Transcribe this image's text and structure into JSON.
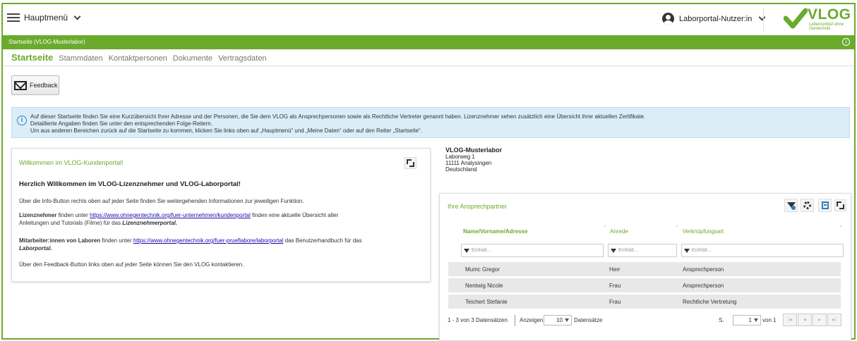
{
  "header": {
    "menu_label": "Hauptmenü",
    "user_label": "Laborportal-Nutzer:in",
    "logo_text": "VLOG",
    "logo_sub": "Lebensmittel ohne Gentechnik"
  },
  "breadcrumb": "Startseite (VLOG-Musterlabor)",
  "tabs": [
    "Startseite",
    "Stammdaten",
    "Kontaktpersonen",
    "Dokumente",
    "Vertragsdaten"
  ],
  "feedback_label": "Feedback",
  "banner": {
    "line1": "Auf dieser Startseite finden Sie eine Kurzübersicht Ihrer Adresse und der Personen, die Sie dem VLOG als Ansprechpersonen sowie als Rechtliche Vertreter genannt haben. Lizenznehmer sehen zusätzlich eine Übersicht ihrer aktuellen Zertifikate.",
    "line2": "Detaillierte Angaben finden Sie unter den entsprechenden Folge-Reitern.",
    "line3": "Um aus anderen Bereichen zurück auf die Startseite zu kommen, klicken Sie links oben auf „Hauptmenü“ und „Meine Daten“ oder auf den Reiter „Startseite“."
  },
  "welcome": {
    "title": "Willkommen im VLOG-Kundenportal!",
    "heading": "Herzlich Willkommen im VLOG-Lizenznehmer und VLOG-Laborportal!",
    "p1": "Über die Info-Button rechts oben auf jeder Seite finden Sie weitergehenden Informationen zur jeweiligen Funktion.",
    "p2_bold": "Lizenznehmer",
    "p2_pre": " finden unter ",
    "p2_link": "https://www.ohnegentechnik.org/fuer-unternehmen/kundenportal",
    "p2_post": " finden eine aktuelle Übersicht aller",
    "p2_line2": "Anleitungen und Tutorials (Filme) für das ",
    "p2_italic": "Lizenznehmerportal.",
    "p3_bold": "Mitarbeiter:innen von Laboren",
    "p3_pre": " finden unter ",
    "p3_link": "https://www.ohnegentechnik.org/fuer-prueflabore/laborportal",
    "p3_post": " das Benutzerhandbuch für das",
    "p3_italic": "Laborportal.",
    "p4": "Über den Feedback-Button links oben auf jeder Seite können Sie den VLOG kontaktieren."
  },
  "address": {
    "name": "VLOG-Musterlabor",
    "street": "Laborweg 1",
    "city": "11111 Analysingen",
    "country": "Deutschland"
  },
  "contacts": {
    "title": "Ihre Ansprechpartner",
    "columns": [
      "Name/Vorname/Adresse",
      "Anrede",
      "Verknüpfungsart"
    ],
    "filter_placeholder": "Enthält...",
    "rows": [
      [
        "Mumc Gregor",
        "Herr",
        "Ansprechperson"
      ],
      [
        "Nentwig Nicole",
        "Frau",
        "Ansprechperson"
      ],
      [
        "Teichert Stefanie",
        "Frau",
        "Rechtliche Vertretung"
      ]
    ],
    "summary": "1 - 3 von 3 Datensätzen",
    "show_label": "Anzeigen",
    "page_size": "10",
    "records_label": "Datensätze",
    "page_prefix": "S.",
    "page_current": "1",
    "page_of": "von 1"
  }
}
